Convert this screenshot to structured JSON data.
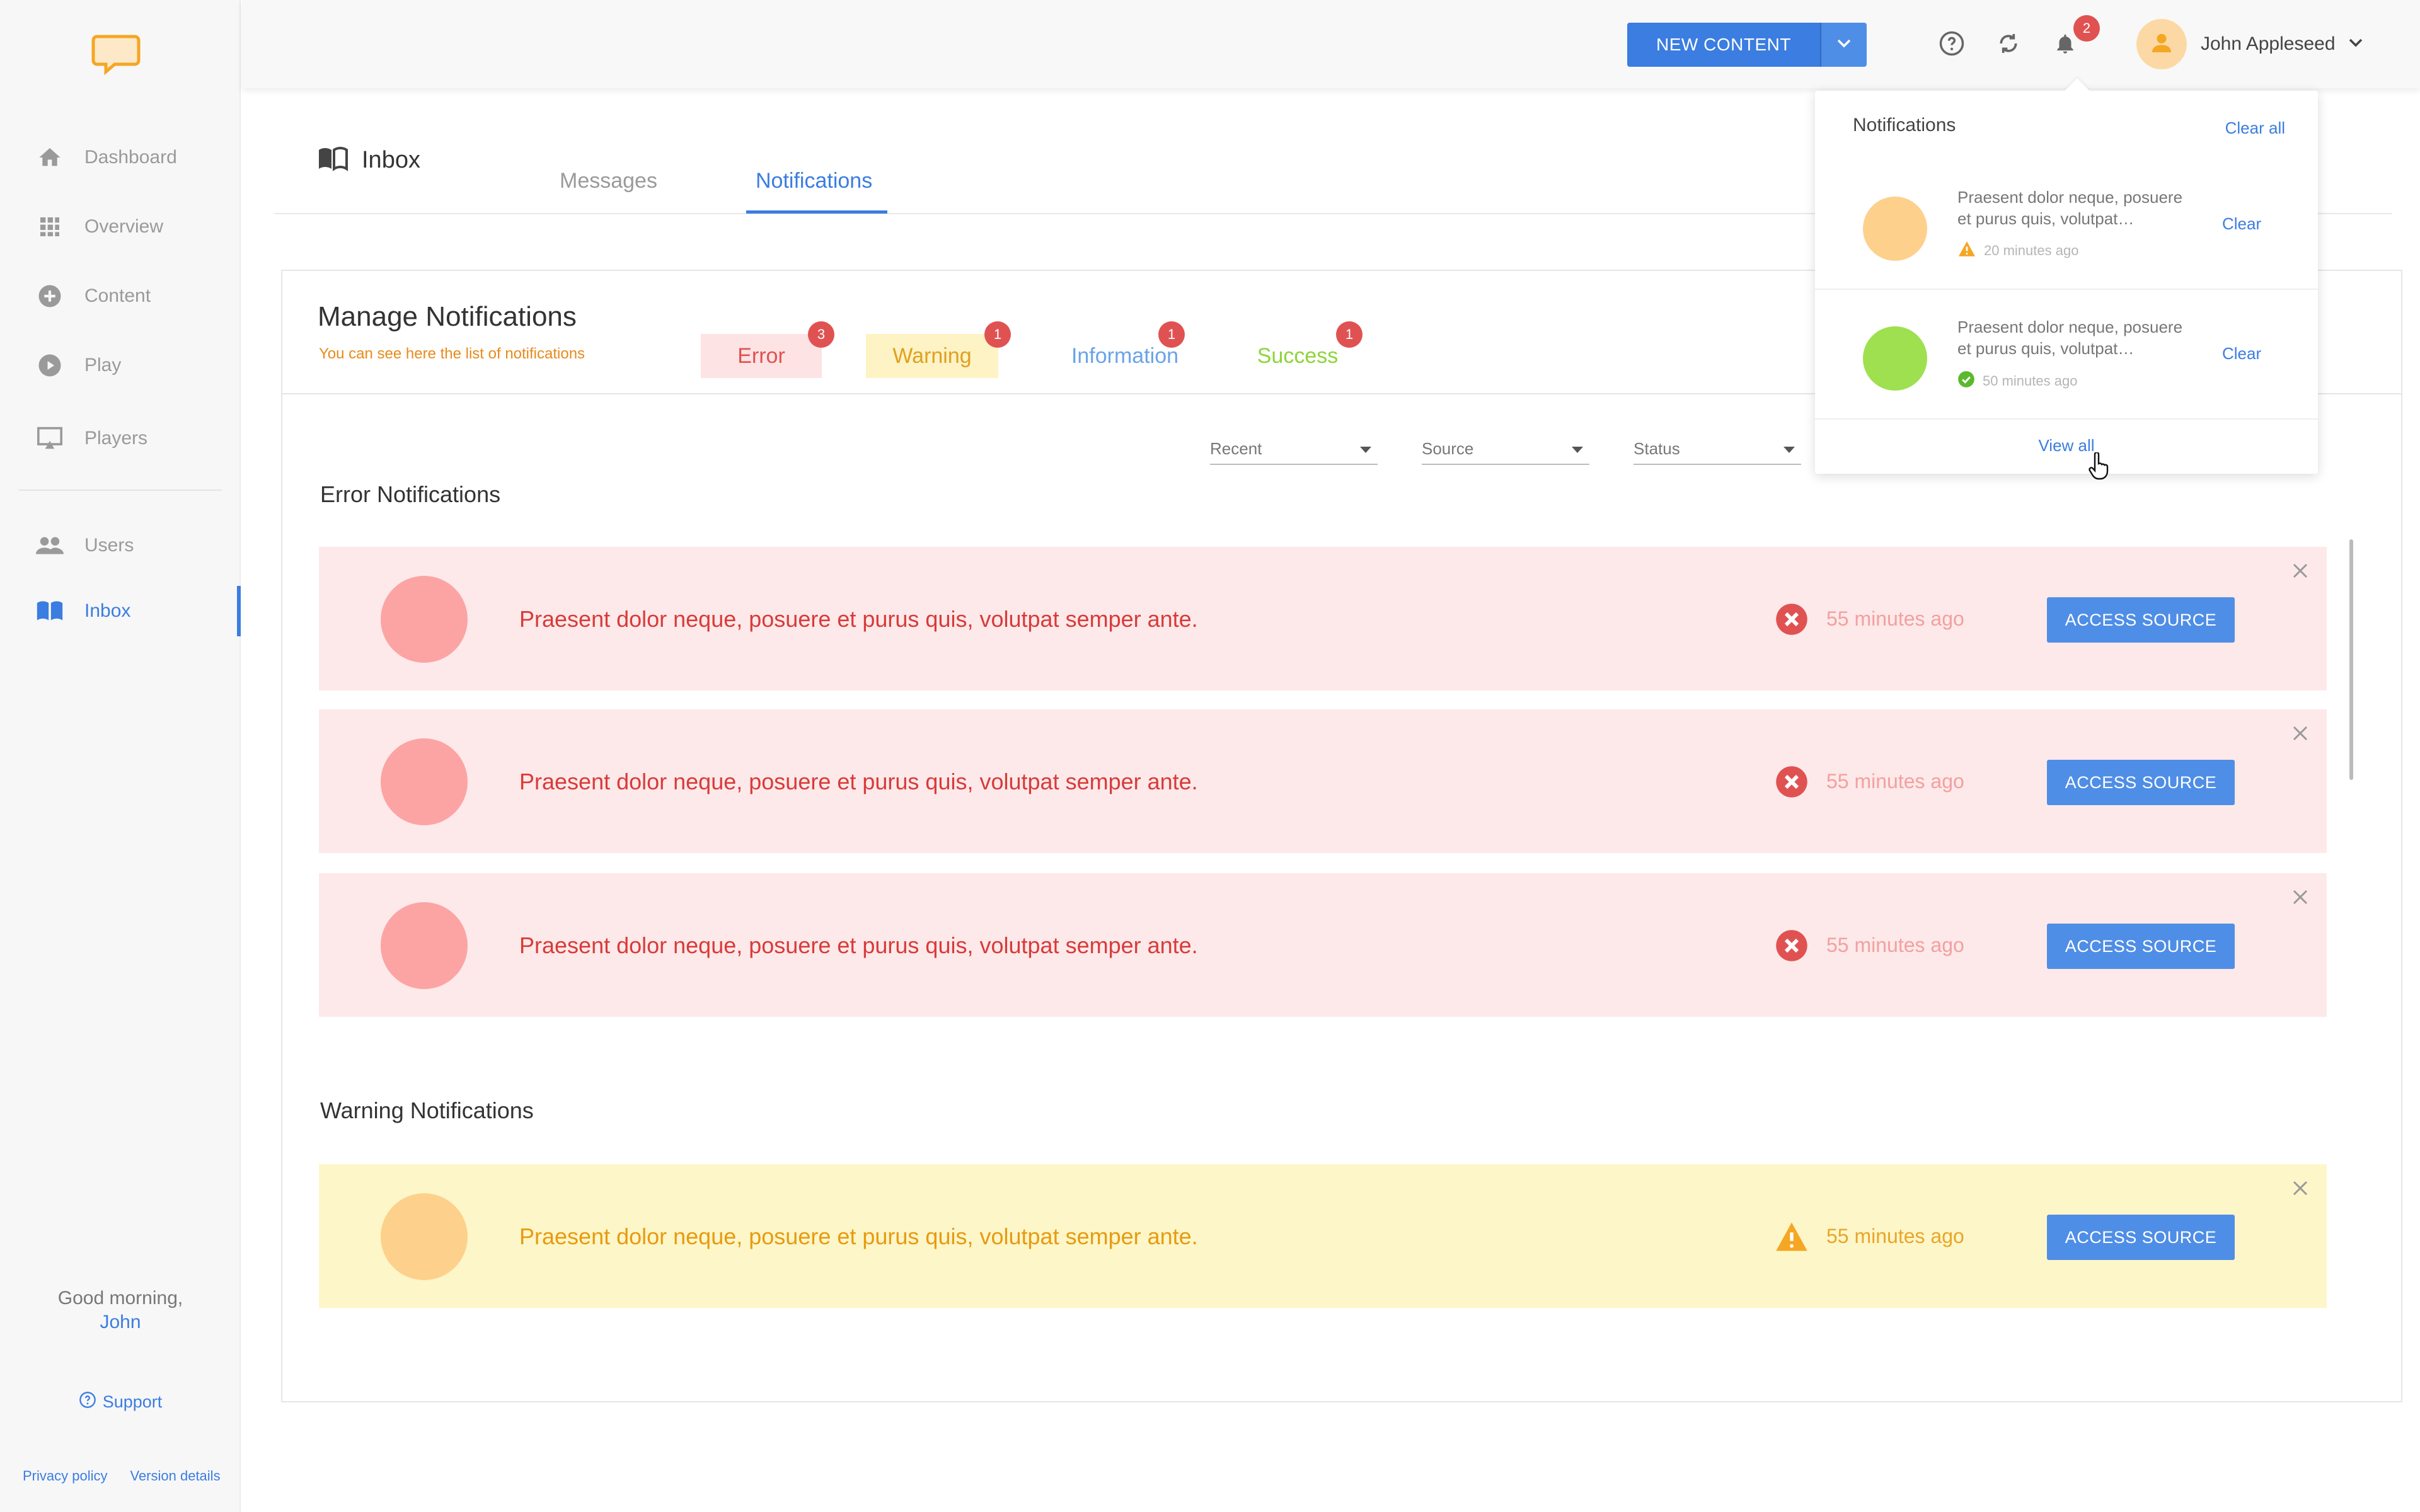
{
  "sidebar": {
    "items": [
      {
        "label": "Dashboard",
        "icon": "home-icon"
      },
      {
        "label": "Overview",
        "icon": "grid-icon"
      },
      {
        "label": "Content",
        "icon": "plus-circle-icon"
      },
      {
        "label": "Play",
        "icon": "play-circle-icon"
      },
      {
        "label": "Players",
        "icon": "monitor-icon"
      },
      {
        "label": "Users",
        "icon": "users-icon"
      },
      {
        "label": "Inbox",
        "icon": "book-icon"
      }
    ],
    "active": "Inbox",
    "greeting": "Good morning,",
    "greeting_name": "John",
    "support": "Support",
    "privacy": "Privacy policy",
    "version": "Version details"
  },
  "topbar": {
    "new_content": "NEW CONTENT",
    "bell_count": "2",
    "user_name": "John Appleseed"
  },
  "page": {
    "title": "Inbox",
    "tabs": [
      {
        "label": "Messages"
      },
      {
        "label": "Notifications"
      }
    ],
    "active_tab": "Notifications"
  },
  "manage": {
    "title": "Manage Notifications",
    "subtitle": "You can see here the list of notifications",
    "filters": [
      {
        "label": "Error",
        "count": "3"
      },
      {
        "label": "Warning",
        "count": "1"
      },
      {
        "label": "Information",
        "count": "1"
      },
      {
        "label": "Success",
        "count": "1"
      }
    ],
    "selects": [
      "Recent",
      "Source",
      "Status"
    ]
  },
  "sections": {
    "error_title": "Error Notifications",
    "warning_title": "Warning Notifications"
  },
  "notifications": {
    "error": [
      {
        "message": "Praesent dolor neque, posuere et purus quis, volutpat semper ante.",
        "time": "55 minutes ago",
        "action": "ACCESS SOURCE"
      },
      {
        "message": "Praesent dolor neque, posuere et purus quis, volutpat semper ante.",
        "time": "55 minutes ago",
        "action": "ACCESS SOURCE"
      },
      {
        "message": "Praesent dolor neque, posuere et purus quis, volutpat semper ante.",
        "time": "55 minutes ago",
        "action": "ACCESS SOURCE"
      }
    ],
    "warning": [
      {
        "message": "Praesent dolor neque, posuere et purus quis, volutpat semper ante.",
        "time": "55 minutes ago",
        "action": "ACCESS SOURCE"
      }
    ]
  },
  "dropdown": {
    "title": "Notifications",
    "clear_all": "Clear all",
    "items": [
      {
        "text": "Praesent dolor neque, posuere et purus quis, volutpat…",
        "time": "20 minutes ago",
        "clear": "Clear",
        "color": "#fdd18c",
        "status_icon": "warning-triangle-icon"
      },
      {
        "text": "Praesent dolor neque, posuere et purus quis, volutpat…",
        "time": "50 minutes ago",
        "clear": "Clear",
        "color": "#9ee04f",
        "status_icon": "check-circle-icon"
      }
    ],
    "view_all": "View all"
  },
  "colors": {
    "accent": "#3b7de0",
    "error": "#e05252",
    "warning": "#e89a10",
    "success": "#8dd43a",
    "logo": "#f5a623"
  }
}
